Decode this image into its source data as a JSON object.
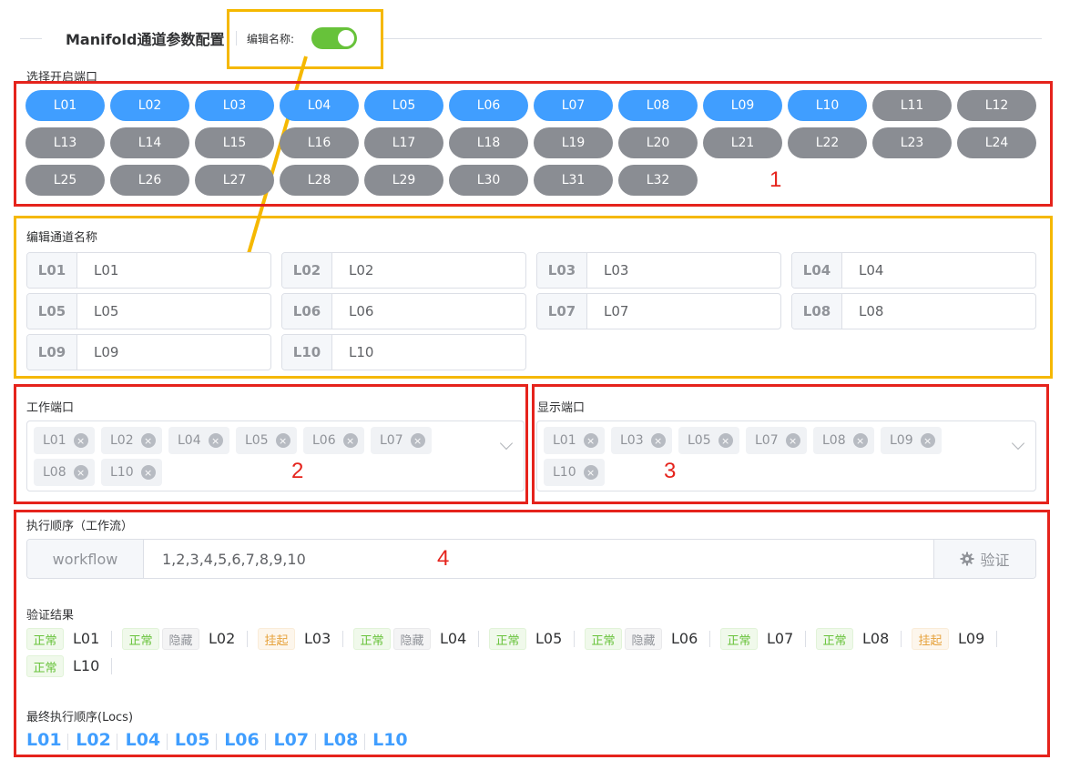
{
  "header": {
    "title": "Manifold通道参数配置",
    "edit_name_label": "编辑名称:",
    "edit_name_enabled": true
  },
  "ports": {
    "label": "选择开启端口",
    "items": [
      {
        "label": "L01",
        "on": true
      },
      {
        "label": "L02",
        "on": true
      },
      {
        "label": "L03",
        "on": true
      },
      {
        "label": "L04",
        "on": true
      },
      {
        "label": "L05",
        "on": true
      },
      {
        "label": "L06",
        "on": true
      },
      {
        "label": "L07",
        "on": true
      },
      {
        "label": "L08",
        "on": true
      },
      {
        "label": "L09",
        "on": true
      },
      {
        "label": "L10",
        "on": true
      },
      {
        "label": "L11",
        "on": false
      },
      {
        "label": "L12",
        "on": false
      },
      {
        "label": "L13",
        "on": false
      },
      {
        "label": "L14",
        "on": false
      },
      {
        "label": "L15",
        "on": false
      },
      {
        "label": "L16",
        "on": false
      },
      {
        "label": "L17",
        "on": false
      },
      {
        "label": "L18",
        "on": false
      },
      {
        "label": "L19",
        "on": false
      },
      {
        "label": "L20",
        "on": false
      },
      {
        "label": "L21",
        "on": false
      },
      {
        "label": "L22",
        "on": false
      },
      {
        "label": "L23",
        "on": false
      },
      {
        "label": "L24",
        "on": false
      },
      {
        "label": "L25",
        "on": false
      },
      {
        "label": "L26",
        "on": false
      },
      {
        "label": "L27",
        "on": false
      },
      {
        "label": "L28",
        "on": false
      },
      {
        "label": "L29",
        "on": false
      },
      {
        "label": "L30",
        "on": false
      },
      {
        "label": "L31",
        "on": false
      },
      {
        "label": "L32",
        "on": false
      }
    ]
  },
  "annotations": [
    "1",
    "2",
    "3",
    "4"
  ],
  "channel_names": {
    "label": "编辑通道名称",
    "items": [
      {
        "prefix": "L01",
        "value": "L01"
      },
      {
        "prefix": "L02",
        "value": "L02"
      },
      {
        "prefix": "L03",
        "value": "L03"
      },
      {
        "prefix": "L04",
        "value": "L04"
      },
      {
        "prefix": "L05",
        "value": "L05"
      },
      {
        "prefix": "L06",
        "value": "L06"
      },
      {
        "prefix": "L07",
        "value": "L07"
      },
      {
        "prefix": "L08",
        "value": "L08"
      },
      {
        "prefix": "L09",
        "value": "L09"
      },
      {
        "prefix": "L10",
        "value": "L10"
      }
    ]
  },
  "work_ports": {
    "label": "工作端口",
    "tags": [
      "L01",
      "L02",
      "L04",
      "L05",
      "L06",
      "L07",
      "L08",
      "L10"
    ]
  },
  "display_ports": {
    "label": "显示端口",
    "tags": [
      "L01",
      "L03",
      "L05",
      "L07",
      "L08",
      "L09",
      "L10"
    ]
  },
  "workflow": {
    "label": "执行顺序（工作流）",
    "prefix": "workflow",
    "value": "1,2,3,4,5,6,7,8,9,10",
    "verify_label": "验证"
  },
  "results": {
    "label": "验证结果",
    "items": [
      {
        "badges": [
          "正常"
        ],
        "name": "L01"
      },
      {
        "badges": [
          "正常",
          "隐藏"
        ],
        "name": "L02"
      },
      {
        "badges": [
          "挂起"
        ],
        "name": "L03"
      },
      {
        "badges": [
          "正常",
          "隐藏"
        ],
        "name": "L04"
      },
      {
        "badges": [
          "正常"
        ],
        "name": "L05"
      },
      {
        "badges": [
          "正常",
          "隐藏"
        ],
        "name": "L06"
      },
      {
        "badges": [
          "正常"
        ],
        "name": "L07"
      },
      {
        "badges": [
          "正常"
        ],
        "name": "L08"
      },
      {
        "badges": [
          "挂起"
        ],
        "name": "L09"
      },
      {
        "badges": [
          "正常"
        ],
        "name": "L10"
      }
    ]
  },
  "final_order": {
    "label": "最终执行顺序(Locs)",
    "items": [
      "L01",
      "L02",
      "L04",
      "L05",
      "L06",
      "L07",
      "L08",
      "L10"
    ]
  },
  "colors": {
    "port_on": "#409eff",
    "port_off": "#8a8d93",
    "annotation_red": "#e5231c",
    "annotation_yellow": "#f5b800",
    "switch_on": "#67c23a"
  }
}
